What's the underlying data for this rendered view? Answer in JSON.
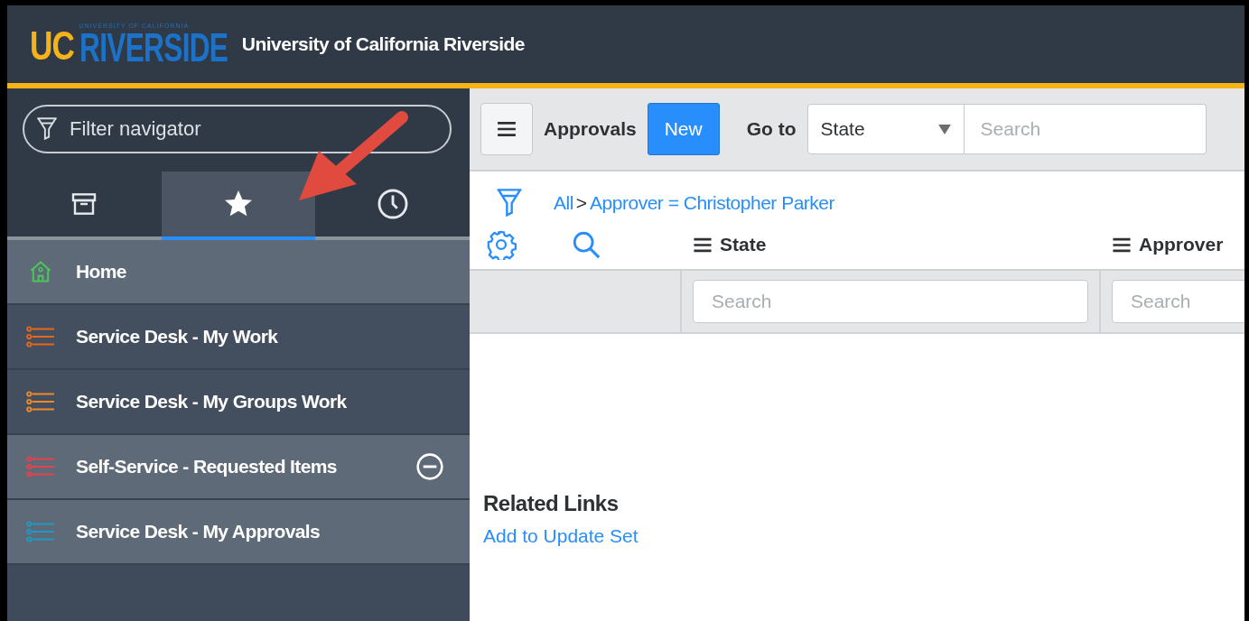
{
  "header": {
    "logo_uc": "UC",
    "logo_name": "RIVERSIDE",
    "logo_tagline": "UNIVERSITY OF CALIFORNIA",
    "title": "University of California Riverside"
  },
  "sidebar": {
    "filter": {
      "placeholder": "Filter navigator"
    },
    "tabs": [
      {
        "kind": "archive",
        "selected": false
      },
      {
        "kind": "star",
        "selected": true
      },
      {
        "kind": "history",
        "selected": false
      }
    ],
    "items": [
      {
        "label": "Home",
        "kind": "home",
        "color": "#4cc35b",
        "highlighted": true,
        "removable": false
      },
      {
        "label": "Service Desk - My Work",
        "kind": "list",
        "color": "#e8671e",
        "highlighted": false,
        "removable": false
      },
      {
        "label": "Service Desk - My Groups Work",
        "kind": "list",
        "color": "#ee8a2a",
        "highlighted": false,
        "removable": false
      },
      {
        "label": "Self-Service - Requested Items",
        "kind": "list",
        "color": "#e8434a",
        "highlighted": true,
        "removable": true
      },
      {
        "label": "Service Desk - My Approvals",
        "kind": "list",
        "color": "#1e9bc4",
        "highlighted": true,
        "removable": false
      }
    ]
  },
  "toolbar": {
    "title": "Approvals",
    "new_button": "New",
    "goto_label": "Go to",
    "goto_field": "State",
    "search": {
      "placeholder": "Search"
    }
  },
  "breadcrumb": {
    "root": "All",
    "separator": ">",
    "condition": "Approver = Christopher Parker"
  },
  "table": {
    "columns": [
      {
        "label": "State",
        "search_placeholder": "Search"
      },
      {
        "label": "Approver",
        "search_placeholder": "Search"
      }
    ]
  },
  "related": {
    "title": "Related Links",
    "links": [
      "Add to Update Set"
    ]
  }
}
